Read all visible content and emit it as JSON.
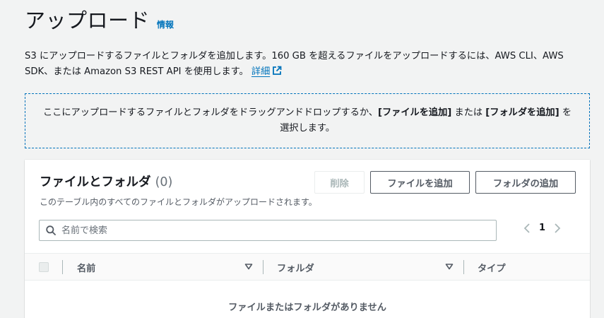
{
  "header": {
    "title": "アップロード",
    "info": "情報"
  },
  "description": {
    "text": "S3 にアップロードするファイルとフォルダを追加します。160 GB を超えるファイルをアップロードするには、AWS CLI、AWS SDK、または Amazon S3 REST API を使用します。",
    "link": "詳細"
  },
  "dropzone": {
    "prefix": "ここにアップロードするファイルとフォルダをドラッグアンドドロップするか、",
    "add_files": "[ファイルを追加]",
    "middle": " または ",
    "add_folder": "[フォルダを追加]",
    "suffix": " を選択します。"
  },
  "panel": {
    "title": "ファイルとフォルダ",
    "count": "(0)",
    "subtitle": "このテーブル内のすべてのファイルとフォルダがアップロードされます。",
    "buttons": {
      "delete": "削除",
      "add_files": "ファイルを追加",
      "add_folder": "フォルダの追加"
    },
    "search": {
      "placeholder": "名前で検索",
      "value": ""
    },
    "pagination": {
      "current_page": "1"
    },
    "columns": [
      "名前",
      "フォルダ",
      "タイプ"
    ],
    "rows": [],
    "empty_text": "ファイルまたはフォルダがありません"
  },
  "colors": {
    "link": "#0073bb",
    "background": "#f2f3f3",
    "text": "#16191f"
  }
}
